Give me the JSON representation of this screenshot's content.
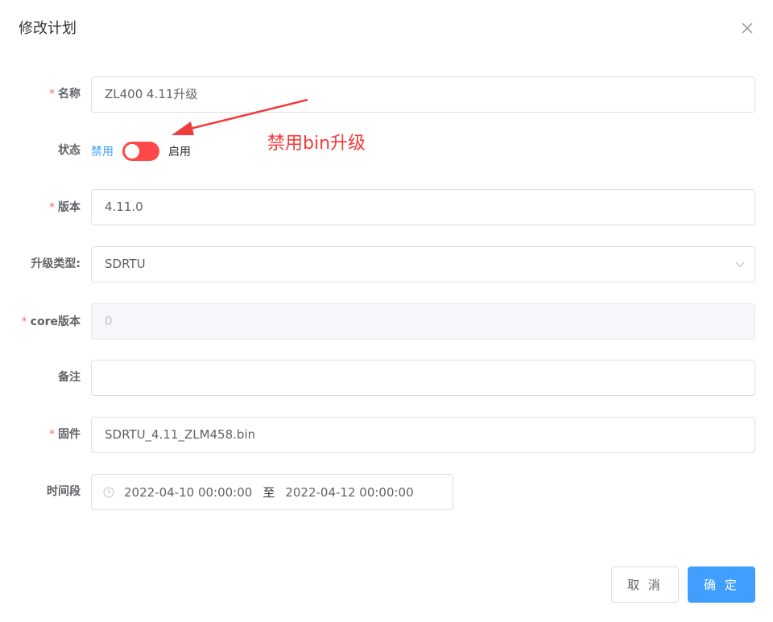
{
  "dialog": {
    "title": "修改计划",
    "close_icon": "close-icon"
  },
  "form": {
    "required_mark": "*",
    "name": {
      "label": "名称",
      "value": "ZL400 4.11升级"
    },
    "status": {
      "label": "状态",
      "inactive_text": "禁用",
      "active_text": "启用",
      "enabled": false
    },
    "version": {
      "label": "版本",
      "value": "4.11.0"
    },
    "upgrade_type": {
      "label": "升级类型:",
      "value": "SDRTU"
    },
    "core_version": {
      "label": "core版本",
      "value": "0"
    },
    "remark": {
      "label": "备注",
      "value": ""
    },
    "firmware": {
      "label": "固件",
      "value": "SDRTU_4.11_ZLM458.bin"
    },
    "time_range": {
      "label": "时间段",
      "start": "2022-04-10 00:00:00",
      "separator": "至",
      "end": "2022-04-12 00:00:00"
    }
  },
  "annotation": {
    "text": "禁用bin升级",
    "color": "#f23b3b"
  },
  "footer": {
    "cancel_label": "取 消",
    "confirm_label": "确 定"
  },
  "colors": {
    "primary": "#409eff",
    "switch_off": "#ff4949",
    "required": "#f56c6c"
  }
}
